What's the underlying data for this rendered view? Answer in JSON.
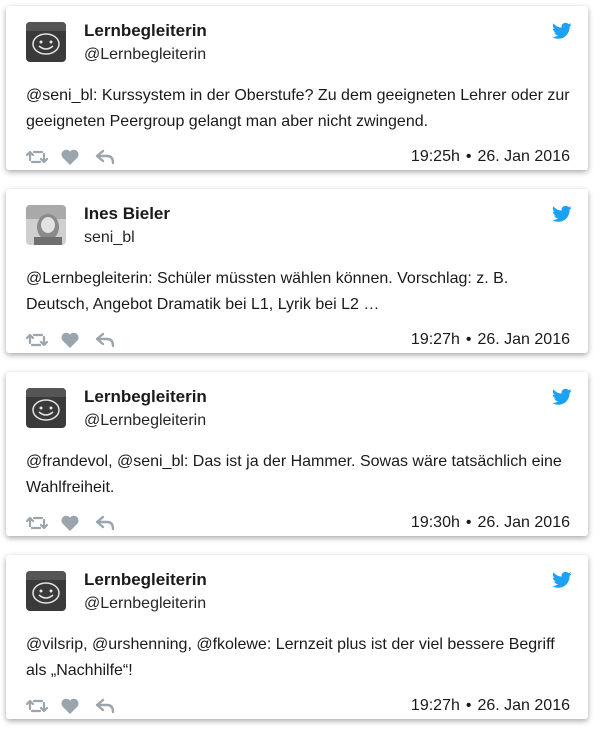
{
  "colors": {
    "twitter_blue": "#1da1f2",
    "action_gray": "#9aa5ad",
    "card_bg": "#ffffff"
  },
  "tweets": [
    {
      "name": "Lernbegleiterin",
      "handle": "@Lernbegleiterin",
      "avatar": "smiley-avatar",
      "text": "@seni_bl: Kurssystem in der Oberstufe? Zu dem geeigneten Lehrer oder zur geeigneten Peergroup gelangt man aber nicht zwingend.",
      "time": "19:25h",
      "date": "26. Jan 2016"
    },
    {
      "name": "Ines Bieler",
      "handle": "seni_bl",
      "avatar": "photo-avatar",
      "text": "@Lernbegleiterin: Schüler müssten wählen können. Vorschlag: z. B. Deutsch, Angebot Dramatik bei L1, Lyrik bei L2 …",
      "time": "19:27h",
      "date": "26. Jan 2016"
    },
    {
      "name": "Lernbegleiterin",
      "handle": "@Lernbegleiterin",
      "avatar": "smiley-avatar",
      "text": "@frandevol, @seni_bl: Das ist ja der Hammer. Sowas wäre tatsächlich eine Wahlfreiheit.",
      "time": "19:30h",
      "date": "26. Jan 2016"
    },
    {
      "name": "Lernbegleiterin",
      "handle": "@Lernbegleiterin",
      "avatar": "smiley-avatar",
      "text": "@vilsrip, @urshenning, @fkolewe: Lernzeit plus ist der viel bessere Begriff als „Nachhilfe“!",
      "time": "19:27h",
      "date": "26. Jan 2016"
    }
  ],
  "separator": "•"
}
